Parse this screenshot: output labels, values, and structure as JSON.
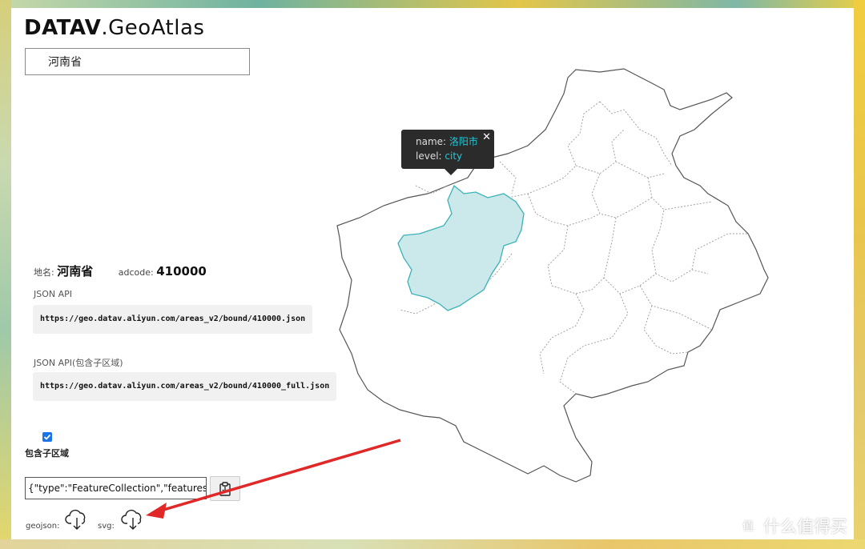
{
  "header": {
    "logo_bold": "DATAV",
    "logo_light": ".GeoAtlas"
  },
  "search": {
    "value": "河南省"
  },
  "info": {
    "name_label": "地名:",
    "name_value": "河南省",
    "adcode_label": "adcode:",
    "adcode_value": "410000"
  },
  "api": {
    "json_api_label": "JSON API",
    "json_api_url": "https://geo.datav.aliyun.com/areas_v2/bound/410000.json",
    "json_api_full_label": "JSON API(包含子区域)",
    "json_api_full_url": "https://geo.datav.aliyun.com/areas_v2/bound/410000_full.json"
  },
  "options": {
    "include_children_label": "包含子区域",
    "include_children_checked": true
  },
  "output": {
    "json_preview": "{\"type\":\"FeatureCollection\",\"features\":"
  },
  "download": {
    "geojson_label": "geojson:",
    "svg_label": "svg:"
  },
  "tooltip": {
    "name_key": "name:",
    "name_value": "洛阳市",
    "level_key": "level:",
    "level_value": "city",
    "close_symbol": "✕"
  },
  "colors": {
    "highlight_fill": "#cbe9ea",
    "highlight_stroke": "#3ab2b8",
    "accent": "#22c7d6",
    "annotation_arrow": "#e02828"
  },
  "watermark": {
    "badge": "值",
    "text": "什么值得买"
  }
}
